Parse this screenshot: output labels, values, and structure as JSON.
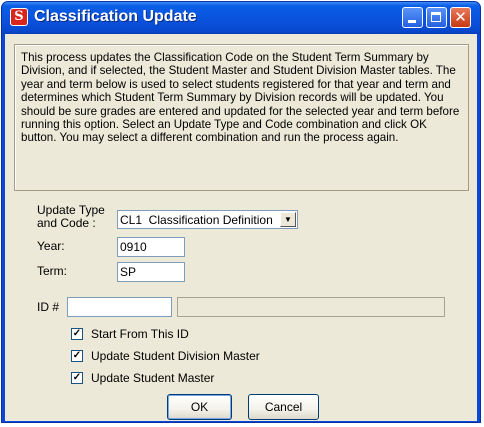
{
  "window": {
    "title": "Classification Update",
    "app_icon_glyph": "S",
    "buttons": [
      "minimize",
      "maximize",
      "close"
    ],
    "close_glyph": "✕"
  },
  "description": "This process updates the Classification Code on the Student Term Summary by Division, and if selected, the Student Master and Student Division Master tables. The year and term below is used to select students registered for that year and term and determines which Student Term Summary by Division records will be updated. You should be sure grades are entered and updated for the selected year and term before running this option. Select an Update Type and Code combination and click OK button. You may select a different combination and run the process again.",
  "form": {
    "update_type_label_line1": "Update Type",
    "update_type_label_line2": "and Code :",
    "update_type_value": "CL1  Classification Definition",
    "year_label": "Year:",
    "year_value": "0910",
    "term_label": "Term:",
    "term_value": "SP",
    "id_label": "ID #",
    "id_value": "",
    "id_name_value": ""
  },
  "options": [
    {
      "label": "Start From This ID",
      "checked": true
    },
    {
      "label": "Update Student Division Master",
      "checked": true
    },
    {
      "label": "Update Student Master",
      "checked": true
    }
  ],
  "checkmark": "✓",
  "buttons": {
    "ok": "OK",
    "cancel": "Cancel"
  },
  "colors": {
    "titlebar": "#0a53de",
    "dialog_bg": "#ece9d8",
    "close_button": "#c63a14"
  }
}
